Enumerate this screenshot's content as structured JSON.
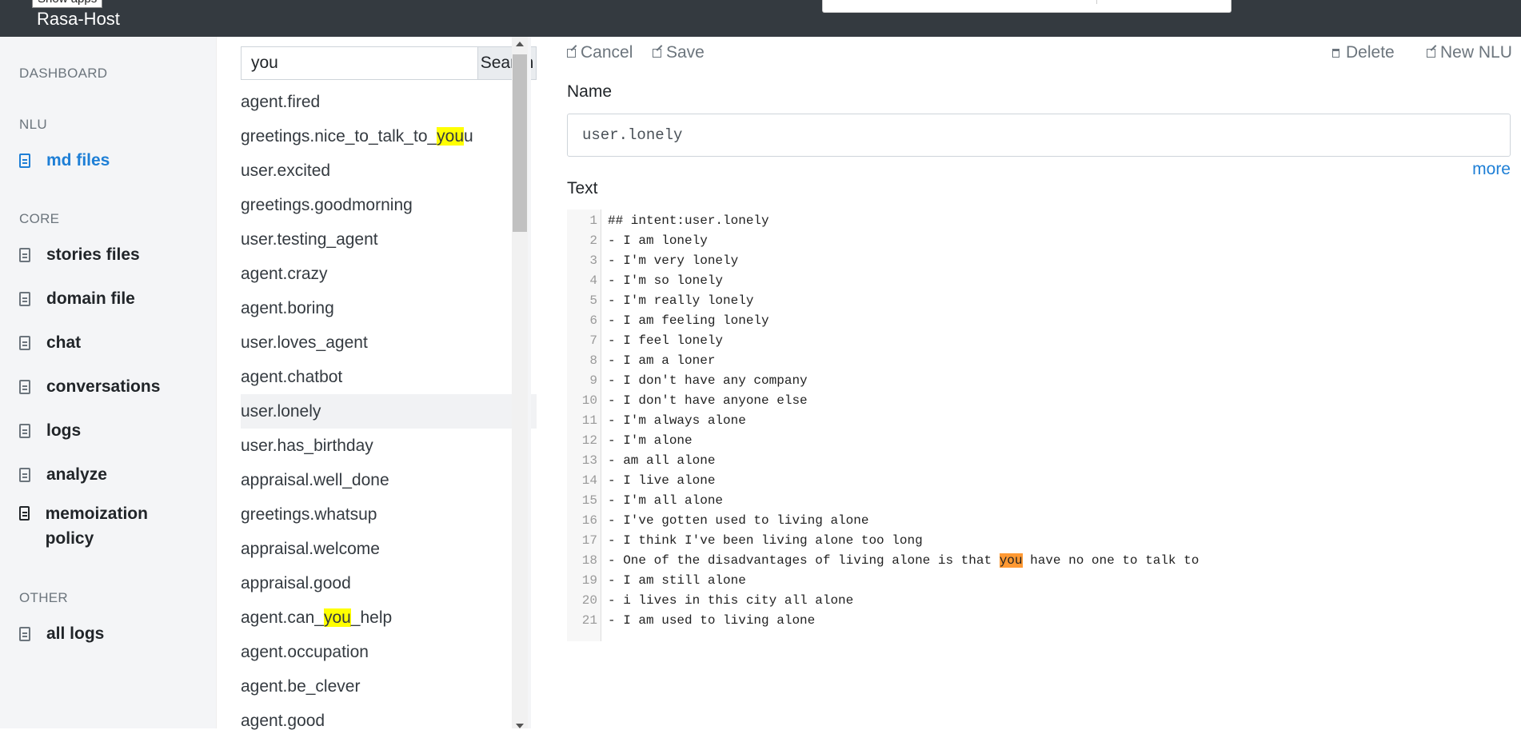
{
  "app": {
    "brand": "Rasa-Host",
    "tooltip": "Show apps"
  },
  "sidebar": {
    "sections": [
      {
        "label": "DASHBOARD"
      },
      {
        "label": "NLU"
      },
      {
        "label": "CORE"
      },
      {
        "label": "OTHER"
      }
    ],
    "items": [
      {
        "label": "md files",
        "active": true
      },
      {
        "label": "stories files"
      },
      {
        "label": "domain file"
      },
      {
        "label": "chat"
      },
      {
        "label": "conversations"
      },
      {
        "label": "logs"
      },
      {
        "label": "analyze"
      },
      {
        "label": "memoization policy"
      },
      {
        "label": "all logs"
      }
    ]
  },
  "search": {
    "value": "you",
    "button": "Search"
  },
  "list": {
    "items": [
      {
        "pre": "agent.fired",
        "hl": "",
        "post": ""
      },
      {
        "pre": "greetings.nice_to_talk_to_",
        "hl": "you",
        "post": "u"
      },
      {
        "pre": "user.excited",
        "hl": "",
        "post": ""
      },
      {
        "pre": "greetings.goodmorning",
        "hl": "",
        "post": ""
      },
      {
        "pre": "user.testing_agent",
        "hl": "",
        "post": ""
      },
      {
        "pre": "agent.crazy",
        "hl": "",
        "post": ""
      },
      {
        "pre": "agent.boring",
        "hl": "",
        "post": ""
      },
      {
        "pre": "user.loves_agent",
        "hl": "",
        "post": ""
      },
      {
        "pre": "agent.chatbot",
        "hl": "",
        "post": ""
      },
      {
        "pre": "user.lonely",
        "hl": "",
        "post": "",
        "selected": true
      },
      {
        "pre": "user.has_birthday",
        "hl": "",
        "post": ""
      },
      {
        "pre": "appraisal.well_done",
        "hl": "",
        "post": ""
      },
      {
        "pre": "greetings.whatsup",
        "hl": "",
        "post": ""
      },
      {
        "pre": "appraisal.welcome",
        "hl": "",
        "post": ""
      },
      {
        "pre": "appraisal.good",
        "hl": "",
        "post": ""
      },
      {
        "pre": "agent.can_",
        "hl": "you",
        "post": "_help"
      },
      {
        "pre": "agent.occupation",
        "hl": "",
        "post": ""
      },
      {
        "pre": "agent.be_clever",
        "hl": "",
        "post": ""
      },
      {
        "pre": "agent.good",
        "hl": "",
        "post": ""
      }
    ]
  },
  "toolbar": {
    "cancel": "Cancel",
    "save": "Save",
    "delete": "Delete",
    "new": "New NLU"
  },
  "form": {
    "name_label": "Name",
    "name_value": "user.lonely",
    "more": "more",
    "text_label": "Text"
  },
  "editor": {
    "lines": [
      {
        "pre": "## intent:user.lonely",
        "hl": "",
        "post": ""
      },
      {
        "pre": "- I am lonely",
        "hl": "",
        "post": ""
      },
      {
        "pre": "- I'm very lonely",
        "hl": "",
        "post": ""
      },
      {
        "pre": "- I'm so lonely",
        "hl": "",
        "post": ""
      },
      {
        "pre": "- I'm really lonely",
        "hl": "",
        "post": ""
      },
      {
        "pre": "- I am feeling lonely",
        "hl": "",
        "post": ""
      },
      {
        "pre": "- I feel lonely",
        "hl": "",
        "post": ""
      },
      {
        "pre": "- I am a loner",
        "hl": "",
        "post": ""
      },
      {
        "pre": "- I don't have any company",
        "hl": "",
        "post": ""
      },
      {
        "pre": "- I don't have anyone else",
        "hl": "",
        "post": ""
      },
      {
        "pre": "- I'm always alone",
        "hl": "",
        "post": ""
      },
      {
        "pre": "- I'm alone",
        "hl": "",
        "post": ""
      },
      {
        "pre": "- am all alone",
        "hl": "",
        "post": ""
      },
      {
        "pre": "- I live alone",
        "hl": "",
        "post": ""
      },
      {
        "pre": "- I'm all alone",
        "hl": "",
        "post": ""
      },
      {
        "pre": "- I've gotten used to living alone",
        "hl": "",
        "post": ""
      },
      {
        "pre": "- I think I've been living alone too long",
        "hl": "",
        "post": ""
      },
      {
        "pre": "- One of the disadvantages of living alone is that ",
        "hl": "you",
        "post": " have no one to talk to"
      },
      {
        "pre": "- I am still alone",
        "hl": "",
        "post": ""
      },
      {
        "pre": "- i lives in this city all alone",
        "hl": "",
        "post": ""
      },
      {
        "pre": "- I am used to living alone",
        "hl": "",
        "post": ""
      }
    ]
  }
}
